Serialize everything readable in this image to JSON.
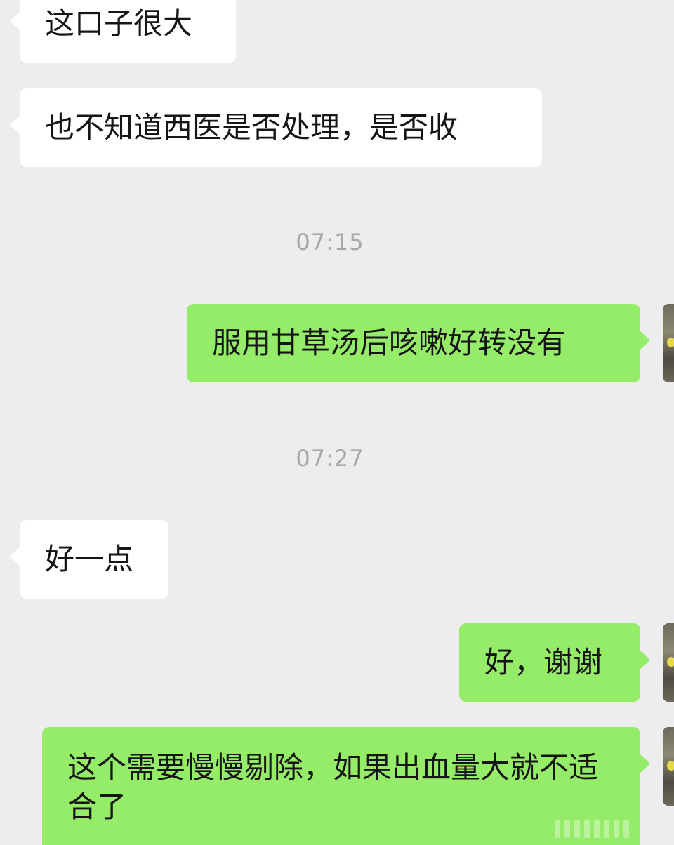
{
  "messages": [
    {
      "side": "in",
      "text": "这口子很大"
    },
    {
      "side": "in",
      "text": "也不知道西医是否处理，是否收"
    },
    {
      "time": "07:15"
    },
    {
      "side": "out",
      "text": "服用甘草汤后咳嗽好转没有"
    },
    {
      "time": "07:27"
    },
    {
      "side": "in",
      "text": "好一点"
    },
    {
      "side": "out",
      "text": "好，谢谢"
    },
    {
      "side": "out",
      "text": "这个需要慢慢剔除，如果出血量大就不适合了"
    }
  ],
  "colors": {
    "background": "#ededed",
    "incoming_bubble": "#ffffff",
    "outgoing_bubble": "#95ec69",
    "timestamp": "#a8a8a8"
  }
}
